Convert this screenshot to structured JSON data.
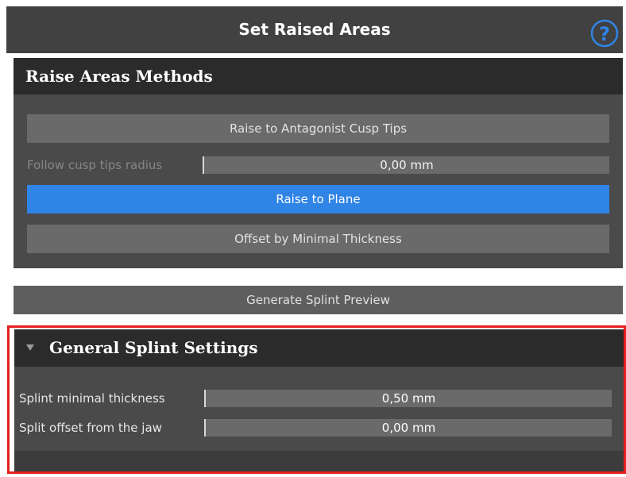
{
  "window": {
    "title": "Set Raised Areas",
    "help_icon": "question-circle-icon",
    "help_glyph": "?",
    "accent_color": "#2f84e6",
    "highlight_color": "#e32020"
  },
  "raise_methods": {
    "title": "Raise Areas Methods",
    "buttons": {
      "antagonist": "Raise to Antagonist Cusp Tips",
      "plane": "Raise to Plane",
      "offset": "Offset by Minimal Thickness"
    },
    "cusp_radius": {
      "label": "Follow cusp tips radius",
      "value": "0,00 mm",
      "enabled": false
    },
    "selected": "plane"
  },
  "preview": {
    "label": "Generate Splint Preview"
  },
  "general_settings": {
    "title": "General Splint Settings",
    "expanded": true,
    "fields": [
      {
        "label": "Splint minimal thickness",
        "value": "0,50 mm"
      },
      {
        "label": "Split offset from the jaw",
        "value": "0,00 mm"
      }
    ]
  }
}
